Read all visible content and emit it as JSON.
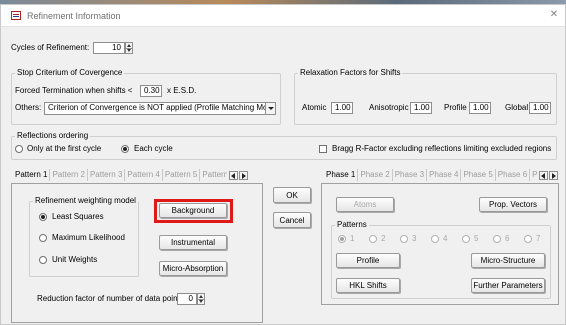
{
  "window": {
    "title": "Refinement Information",
    "close_glyph": "✕"
  },
  "cycles": {
    "label": "Cycles of Refinement:",
    "value": "10"
  },
  "stop_criterium": {
    "title": "Stop Criterium of Covergence",
    "forced_label": "Forced Termination when  shifts <",
    "forced_value": "0.30",
    "forced_suffix": "x  E.S.D.",
    "others_label": "Others:",
    "others_value": "Criterion of Convergence is NOT applied (Profile Matching Mode)"
  },
  "relaxation": {
    "title": "Relaxation Factors for Shifts",
    "atomic_label": "Atomic",
    "atomic_value": "1.00",
    "anisotropic_label": "Anisotropic",
    "anisotropic_value": "1.00",
    "profile_label": "Profile",
    "profile_value": "1.00",
    "global_label": "Global",
    "global_value": "1.00"
  },
  "reflections": {
    "title": "Reflections ordering",
    "option_first": "Only at the first cycle",
    "option_each": "Each cycle",
    "selected": "each",
    "bragg_label": "Bragg R-Factor excluding  reflections limiting excluded regions",
    "bragg_checked": false
  },
  "pattern_tabs": [
    "Pattern 1",
    "Pattern 2",
    "Pattern 3",
    "Pattern 4",
    "Pattern 5",
    "Pattern"
  ],
  "pattern_panel": {
    "weighting_title": "Refinement weighting model",
    "weighting_options": [
      "Least Squares",
      "Maximum Likelihood",
      "Unit Weights"
    ],
    "weighting_selected": 0,
    "background_button": "Background",
    "instrumental_button": "Instrumental",
    "microabsorption_button": "Micro-Absorption",
    "reduction_label": "Reduction factor of number of data points:",
    "reduction_value": "0"
  },
  "actions": {
    "ok": "OK",
    "cancel": "Cancel"
  },
  "phase_tabs": [
    "Phase 1",
    "Phase 2",
    "Phase 3",
    "Phase 4",
    "Phase 5",
    "Phase 6",
    "P"
  ],
  "phase_panel": {
    "atoms_button": "Atoms",
    "prop_vectors_button": "Prop. Vectors",
    "patterns_title": "Patterns",
    "pattern_options": [
      "1",
      "2",
      "3",
      "4",
      "5",
      "6",
      "7"
    ],
    "pattern_selected": 0,
    "profile_button": "Profile",
    "microstructure_button": "Micro-Structure",
    "hkl_button": "HKL Shifts",
    "further_button": "Further Parameters"
  },
  "colors": {
    "highlight": "#e01818",
    "disabled_text": "#a8a8a8"
  }
}
